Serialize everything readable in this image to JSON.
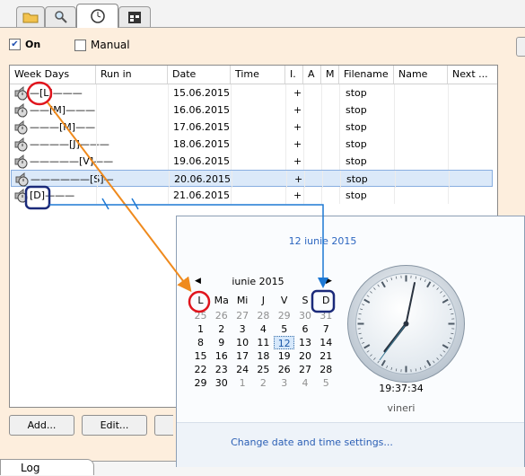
{
  "tabs": [
    {
      "icon": "folder-icon"
    },
    {
      "icon": "magnifier-icon"
    },
    {
      "icon": "clock-icon"
    },
    {
      "icon": "calendar-icon"
    }
  ],
  "toggles": {
    "on_label": "On",
    "on_checked": true,
    "manual_label": "Manual",
    "manual_checked": false
  },
  "grid": {
    "columns": [
      "Week Days",
      "Run in",
      "Date",
      "Time",
      "I.",
      "A",
      "M",
      "Filename",
      "Name",
      "Next ..."
    ],
    "rows": [
      {
        "day": "[L]",
        "date": "15.06.2015",
        "i": "+",
        "file": "stop",
        "selected": false
      },
      {
        "day": "[M]",
        "date": "16.06.2015",
        "i": "+",
        "file": "stop",
        "selected": false
      },
      {
        "day": "[M]",
        "date": "17.06.2015",
        "i": "+",
        "file": "stop",
        "selected": false
      },
      {
        "day": "[J]",
        "date": "18.06.2015",
        "i": "+",
        "file": "stop",
        "selected": false
      },
      {
        "day": "[V]",
        "date": "19.06.2015",
        "i": "+",
        "file": "stop",
        "selected": false
      },
      {
        "day": "[S]",
        "date": "20.06.2015",
        "i": "+",
        "file": "stop",
        "selected": true
      },
      {
        "day": "[D]",
        "date": "21.06.2015",
        "i": "+",
        "file": "stop",
        "selected": false
      }
    ]
  },
  "buttons": {
    "add": "Add...",
    "edit": "Edit..."
  },
  "bottom_tab": "Log",
  "popup": {
    "date_title": "12 iunie 2015",
    "month": "iunie 2015",
    "weekdays": [
      "L",
      "Ma",
      "Mi",
      "J",
      "V",
      "S",
      "D"
    ],
    "weeks": [
      [
        [
          25,
          true
        ],
        [
          26,
          true
        ],
        [
          27,
          true
        ],
        [
          28,
          true
        ],
        [
          29,
          true
        ],
        [
          30,
          true
        ],
        [
          31,
          true
        ]
      ],
      [
        [
          1,
          false
        ],
        [
          2,
          false
        ],
        [
          3,
          false
        ],
        [
          4,
          false
        ],
        [
          5,
          false
        ],
        [
          6,
          false
        ],
        [
          7,
          false
        ]
      ],
      [
        [
          8,
          false
        ],
        [
          9,
          false
        ],
        [
          10,
          false
        ],
        [
          11,
          false
        ],
        [
          12,
          false
        ],
        [
          13,
          false
        ],
        [
          14,
          false
        ]
      ],
      [
        [
          15,
          false
        ],
        [
          16,
          false
        ],
        [
          17,
          false
        ],
        [
          18,
          false
        ],
        [
          19,
          false
        ],
        [
          20,
          false
        ],
        [
          21,
          false
        ]
      ],
      [
        [
          22,
          false
        ],
        [
          23,
          false
        ],
        [
          24,
          false
        ],
        [
          25,
          false
        ],
        [
          26,
          false
        ],
        [
          27,
          false
        ],
        [
          28,
          false
        ]
      ],
      [
        [
          29,
          false
        ],
        [
          30,
          false
        ],
        [
          1,
          true
        ],
        [
          2,
          true
        ],
        [
          3,
          true
        ],
        [
          4,
          true
        ],
        [
          5,
          true
        ]
      ]
    ],
    "today": 12,
    "time": "19:37:34",
    "weekday": "vineri",
    "settings_link": "Change date and time settings..."
  },
  "colors": {
    "panel_bg": "#fdeedd",
    "select": "#dbe9f9",
    "orange_arrow": "#ef8a1d",
    "blue_arrow": "#1d78d4",
    "red_ring": "#e0141c",
    "navy_ring": "#1b2a7a"
  }
}
